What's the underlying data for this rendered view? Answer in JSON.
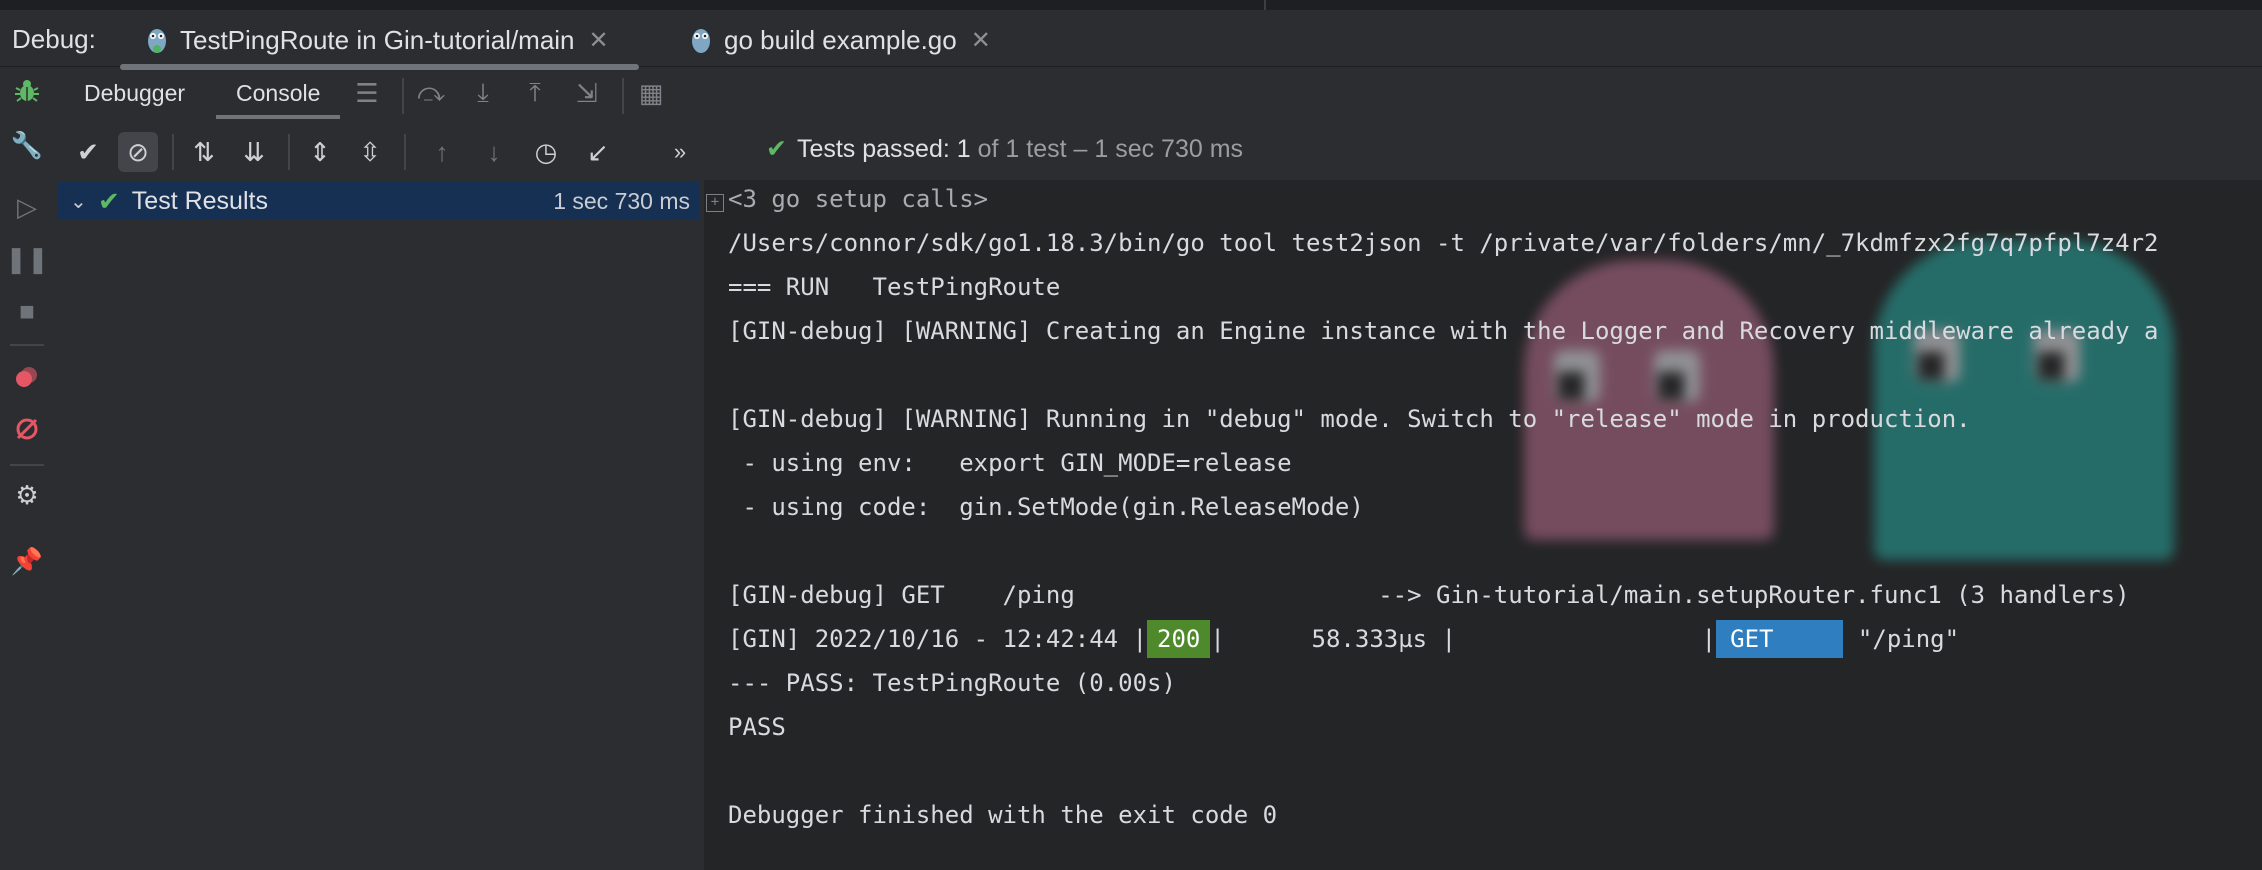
{
  "debug_label": "Debug:",
  "tabs": [
    {
      "label": "TestPingRoute in Gin-tutorial/main",
      "active": true
    },
    {
      "label": "go build example.go",
      "active": false
    }
  ],
  "subtabs": {
    "debugger": "Debugger",
    "console": "Console"
  },
  "status": {
    "prefix": "Tests passed:",
    "count": "1",
    "suffix": "of 1 test – 1 sec 730 ms"
  },
  "tree": {
    "label": "Test Results",
    "time": "1 sec 730 ms"
  },
  "console": {
    "setup": "<3 go setup calls>",
    "lines": [
      "/Users/connor/sdk/go1.18.3/bin/go tool test2json -t /private/var/folders/mn/_7kdmfzx2fg7q7pfpl7z4r2",
      "=== RUN   TestPingRoute",
      "[GIN-debug] [WARNING] Creating an Engine instance with the Logger and Recovery middleware already a",
      "",
      "[GIN-debug] [WARNING] Running in \"debug\" mode. Switch to \"release\" mode in production.",
      " - using env:   export GIN_MODE=release",
      " - using code:  gin.SetMode(gin.ReleaseMode)",
      "",
      "[GIN-debug] GET    /ping                     --> Gin-tutorial/main.setupRouter.func1 (3 handlers)"
    ],
    "gin_log": {
      "prefix": "[GIN] 2022/10/16 - 12:42:44 |",
      "status": "200",
      "mid": "|      58.333µs |                 |",
      "method": "GET",
      "path": " \"/ping\""
    },
    "after": [
      "--- PASS: TestPingRoute (0.00s)",
      "PASS",
      "",
      "Debugger finished with the exit code 0"
    ]
  },
  "colors": {
    "pass_green": "#5fb865",
    "status_200": "#4e8a2c",
    "method_get": "#2f7fc0",
    "selection": "#163053"
  }
}
